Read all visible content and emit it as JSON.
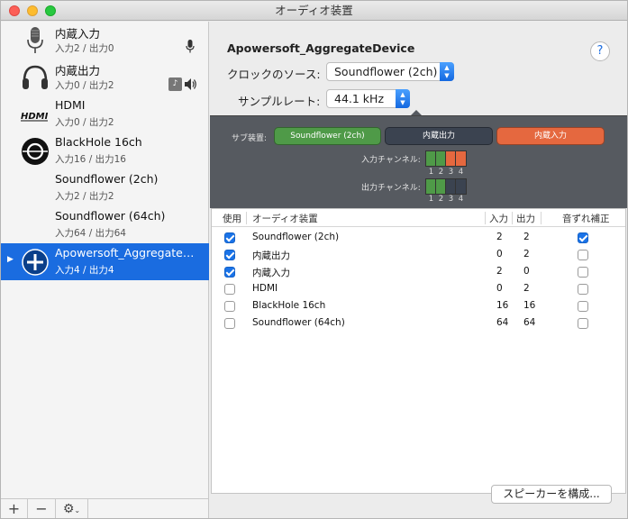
{
  "window_title": "オーディオ装置",
  "devices": [
    {
      "name": "内蔵入力",
      "channels": "入力2 / 出力0",
      "icon": "microphone-icon"
    },
    {
      "name": "内蔵出力",
      "channels": "入力0 / 出力2",
      "icon": "headphones-icon"
    },
    {
      "name": "HDMI",
      "channels": "入力0 / 出力2",
      "icon": "hdmi-logo-icon"
    },
    {
      "name": "BlackHole 16ch",
      "channels": "入力16 / 出力16",
      "icon": "blackhole-icon"
    },
    {
      "name": "Soundflower (2ch)",
      "channels": "入力2 / 出力2",
      "icon": ""
    },
    {
      "name": "Soundflower (64ch)",
      "channels": "入力64 / 出力64",
      "icon": ""
    },
    {
      "name": "Apowersoft_Aggregate…",
      "channels": "入力4 / 出力4",
      "icon": "aggregate-plus-icon",
      "selected": true
    }
  ],
  "detail": {
    "device_title": "Apowersoft_AggregateDevice",
    "clock_label": "クロックのソース:",
    "clock_value": "Soundflower (2ch)",
    "rate_label": "サンプルレート:",
    "rate_value": "44.1 kHz",
    "help": "?"
  },
  "subdevice": {
    "label": "サブ装置:",
    "chips": [
      {
        "label": "Soundflower (2ch)",
        "color": "#4f9a48"
      },
      {
        "label": "内蔵出力",
        "color": "#3b4350"
      },
      {
        "label": "内蔵入力",
        "color": "#e5683f"
      }
    ],
    "input_channels_label": "入力チャンネル:",
    "output_channels_label": "出力チャンネル:",
    "channel_numbers": [
      "1",
      "2",
      "3",
      "4"
    ]
  },
  "table": {
    "headers": {
      "use": "使用",
      "device": "オーディオ装置",
      "in": "入力",
      "out": "出力",
      "drift": "音ずれ補正"
    },
    "rows": [
      {
        "use": true,
        "device": "Soundflower (2ch)",
        "in": "2",
        "out": "2",
        "drift": true
      },
      {
        "use": true,
        "device": "内蔵出力",
        "in": "0",
        "out": "2",
        "drift": false
      },
      {
        "use": true,
        "device": "内蔵入力",
        "in": "2",
        "out": "0",
        "drift": false
      },
      {
        "use": false,
        "device": "HDMI",
        "in": "0",
        "out": "2",
        "drift": false
      },
      {
        "use": false,
        "device": "BlackHole 16ch",
        "in": "16",
        "out": "16",
        "drift": false
      },
      {
        "use": false,
        "device": "Soundflower (64ch)",
        "in": "64",
        "out": "64",
        "drift": false
      }
    ]
  },
  "speaker_button": "スピーカーを構成...",
  "sidebar_toolbar": {
    "add": "+",
    "remove": "−",
    "gear": "⚙"
  }
}
